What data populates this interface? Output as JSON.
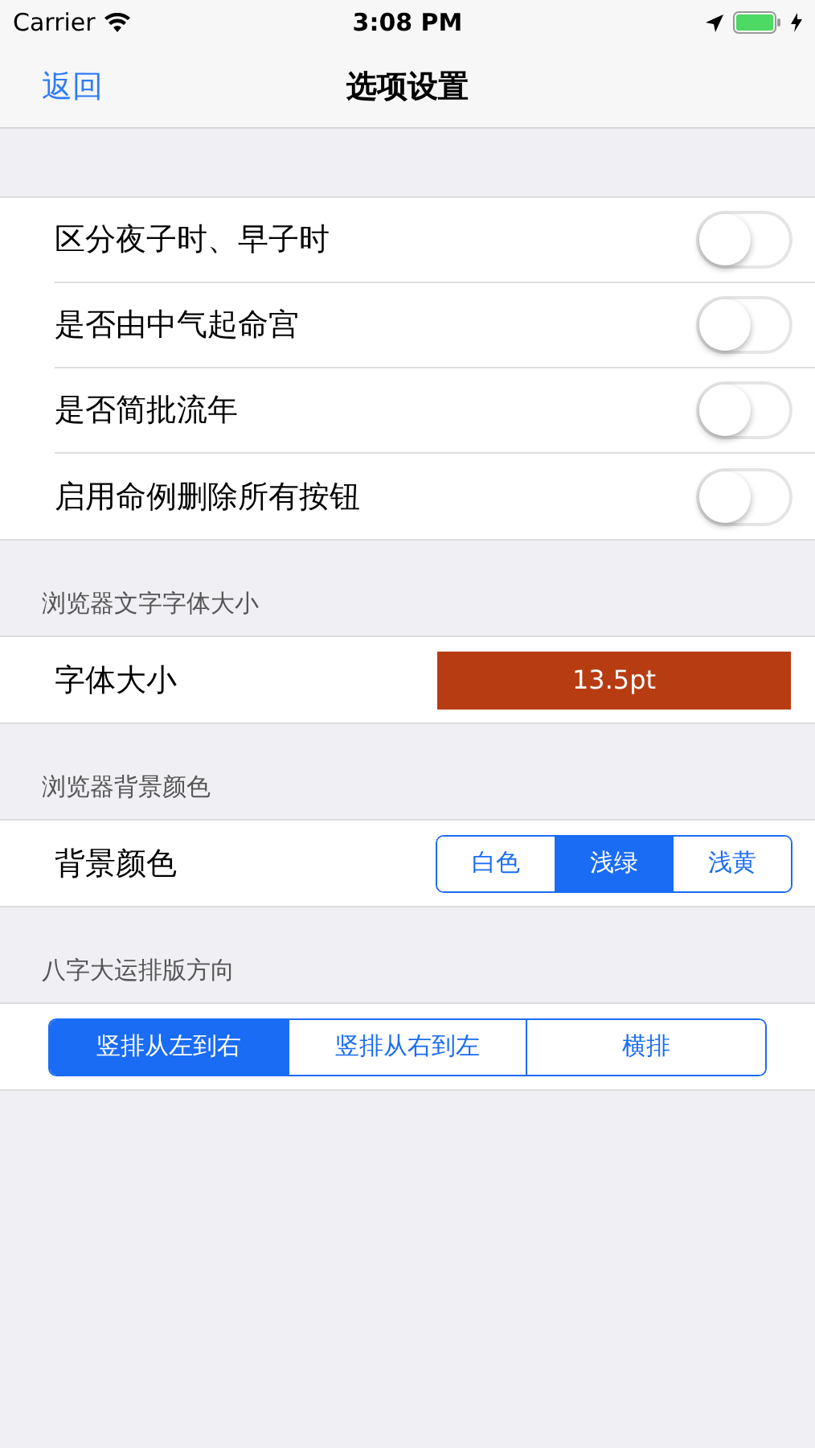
{
  "status_bar": {
    "carrier": "Carrier",
    "time": "3:08 PM"
  },
  "nav": {
    "back": "返回",
    "title": "选项设置"
  },
  "toggles": [
    {
      "label": "区分夜子时、早子时",
      "on": false
    },
    {
      "label": "是否由中气起命宫",
      "on": false
    },
    {
      "label": "是否简批流年",
      "on": false
    },
    {
      "label": "启用命例删除所有按钮",
      "on": false
    }
  ],
  "font_section": {
    "header": "浏览器文字字体大小",
    "label": "字体大小",
    "value": "13.5pt"
  },
  "background_section": {
    "header": "浏览器背景颜色",
    "label": "背景颜色",
    "options": [
      {
        "label": "白色",
        "selected": false
      },
      {
        "label": "浅绿",
        "selected": true
      },
      {
        "label": "浅黄",
        "selected": false
      }
    ]
  },
  "direction_section": {
    "header": "八字大运排版方向",
    "options": [
      {
        "label": "竖排从左到右",
        "selected": true
      },
      {
        "label": "竖排从右到左",
        "selected": false
      },
      {
        "label": "横排",
        "selected": false
      }
    ]
  }
}
